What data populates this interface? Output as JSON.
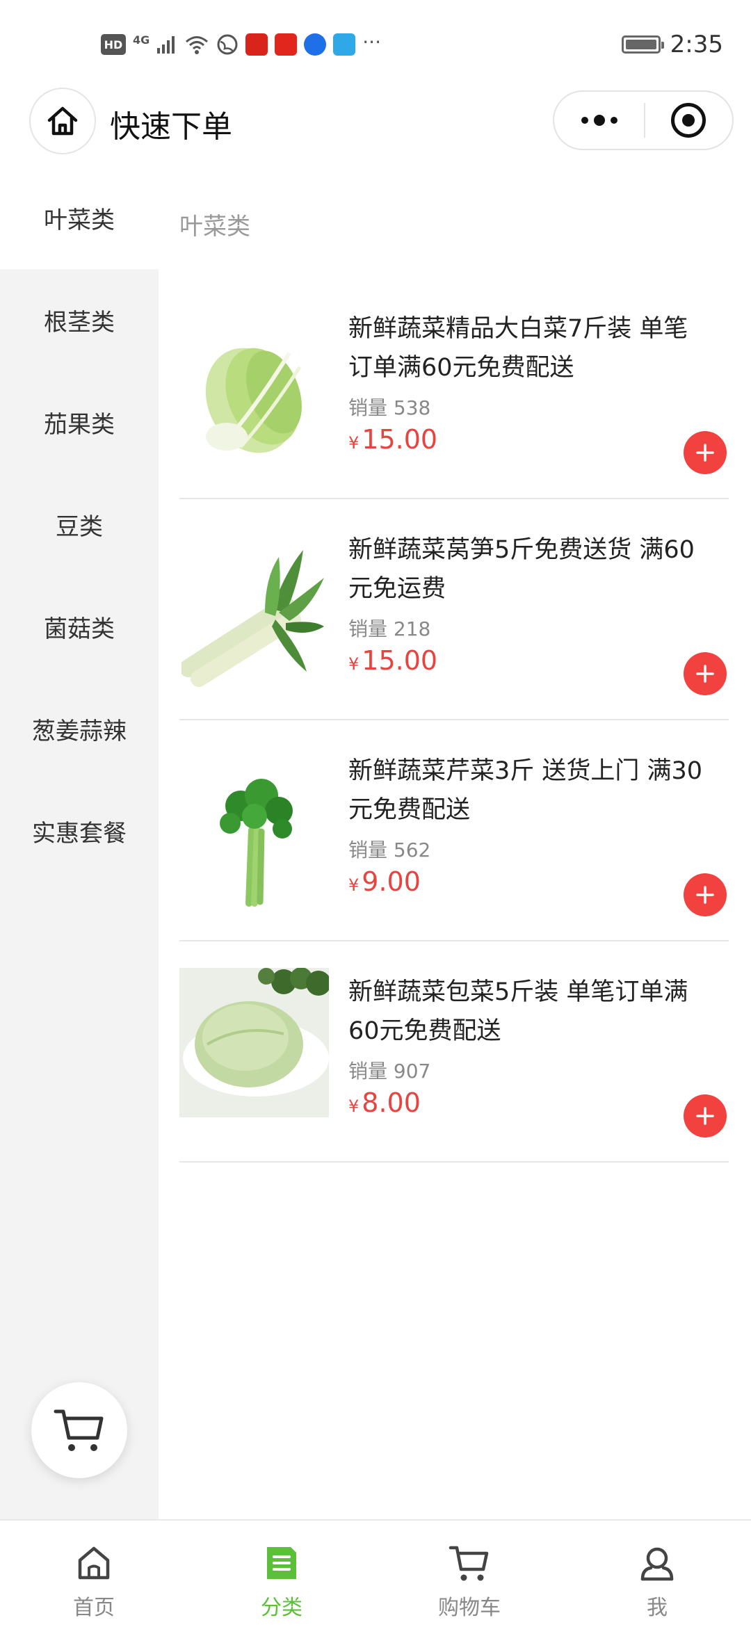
{
  "status_bar": {
    "time": "2:35",
    "network_label": "HD",
    "signal_label": "4G",
    "more_label": "···"
  },
  "header": {
    "title": "快速下单"
  },
  "sidebar": {
    "categories": [
      {
        "label": "叶菜类",
        "active": true
      },
      {
        "label": "根茎类",
        "active": false
      },
      {
        "label": "茄果类",
        "active": false
      },
      {
        "label": "豆类",
        "active": false
      },
      {
        "label": "菌菇类",
        "active": false
      },
      {
        "label": "葱姜蒜辣",
        "active": false
      },
      {
        "label": "实惠套餐",
        "active": false
      }
    ]
  },
  "main": {
    "section_title": "叶菜类",
    "currency_symbol": "¥",
    "products": [
      {
        "name": "新鲜蔬菜精品大白菜7斤装 单笔订单满60元免费配送",
        "sales": "销量 538",
        "price": "15.00",
        "image": "napa-cabbage"
      },
      {
        "name": "新鲜蔬菜莴笋5斤免费送货 满60元免运费",
        "sales": "销量 218",
        "price": "15.00",
        "image": "lettuce-stem"
      },
      {
        "name": "新鲜蔬菜芹菜3斤 送货上门 满30元免费配送",
        "sales": "销量 562",
        "price": "9.00",
        "image": "celery"
      },
      {
        "name": "新鲜蔬菜包菜5斤装 单笔订单满60元免费配送",
        "sales": "销量 907",
        "price": "8.00",
        "image": "cabbage"
      }
    ]
  },
  "tabbar": {
    "tabs": [
      {
        "label": "首页",
        "icon": "home-icon",
        "active": false
      },
      {
        "label": "分类",
        "icon": "category-icon",
        "active": true
      },
      {
        "label": "购物车",
        "icon": "cart-icon",
        "active": false
      },
      {
        "label": "我",
        "icon": "profile-icon",
        "active": false
      }
    ]
  },
  "colors": {
    "accent_green": "#5cbf3a",
    "price_red": "#e8433f",
    "add_button_red": "#f2423f"
  }
}
